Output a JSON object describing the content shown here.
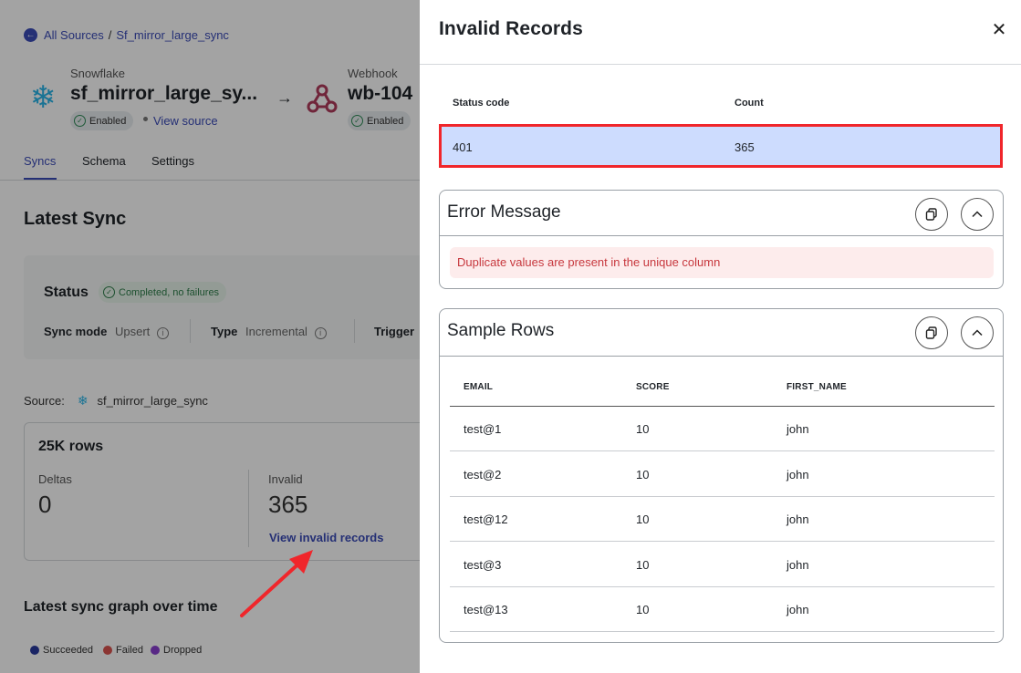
{
  "breadcrumb": {
    "all_sources": "All Sources",
    "separator": "/",
    "current": "Sf_mirror_large_sync"
  },
  "source": {
    "type": "Snowflake",
    "name": "sf_mirror_large_sy...",
    "status": "Enabled",
    "view_source": "View source"
  },
  "destination": {
    "type": "Webhook",
    "name": "wb-104",
    "status": "Enabled"
  },
  "tabs": [
    "Syncs",
    "Schema",
    "Settings"
  ],
  "latest_sync": {
    "title": "Latest Sync",
    "status_label": "Status",
    "status_badge": "Completed, no failures",
    "sync_mode_label": "Sync mode",
    "sync_mode_value": "Upsert",
    "type_label": "Type",
    "type_value": "Incremental",
    "trigger_label": "Trigger"
  },
  "source_line": {
    "label": "Source:",
    "name": "sf_mirror_large_sync"
  },
  "rows_card": {
    "title": "25K rows",
    "deltas_label": "Deltas",
    "deltas_value": "0",
    "invalid_label": "Invalid",
    "invalid_value": "365",
    "view_invalid": "View invalid records"
  },
  "graph": {
    "title": "Latest sync graph over time",
    "legend": [
      {
        "label": "Succeeded",
        "color": "#2a3a9e"
      },
      {
        "label": "Failed",
        "color": "#d9534f"
      },
      {
        "label": "Dropped",
        "color": "#8a3fd1"
      }
    ]
  },
  "drawer": {
    "title": "Invalid Records",
    "status_table": {
      "headers": [
        "Status code",
        "Count"
      ],
      "rows": [
        [
          "401",
          "365"
        ]
      ]
    },
    "error_panel": {
      "title": "Error Message",
      "message": "Duplicate values are present in the unique column"
    },
    "sample_panel": {
      "title": "Sample Rows",
      "headers": [
        "EMAIL",
        "SCORE",
        "FIRST_NAME"
      ],
      "rows": [
        [
          "test@1",
          "10",
          "john"
        ],
        [
          "test@2",
          "10",
          "john"
        ],
        [
          "test@12",
          "10",
          "john"
        ],
        [
          "test@3",
          "10",
          "john"
        ],
        [
          "test@13",
          "10",
          "john"
        ]
      ]
    }
  },
  "colors": {
    "accent": "#3b4bb8",
    "highlight_row": "#cddcfe",
    "highlight_border": "#f0262b",
    "error_bg": "#fdecec",
    "error_text": "#c7373d"
  }
}
